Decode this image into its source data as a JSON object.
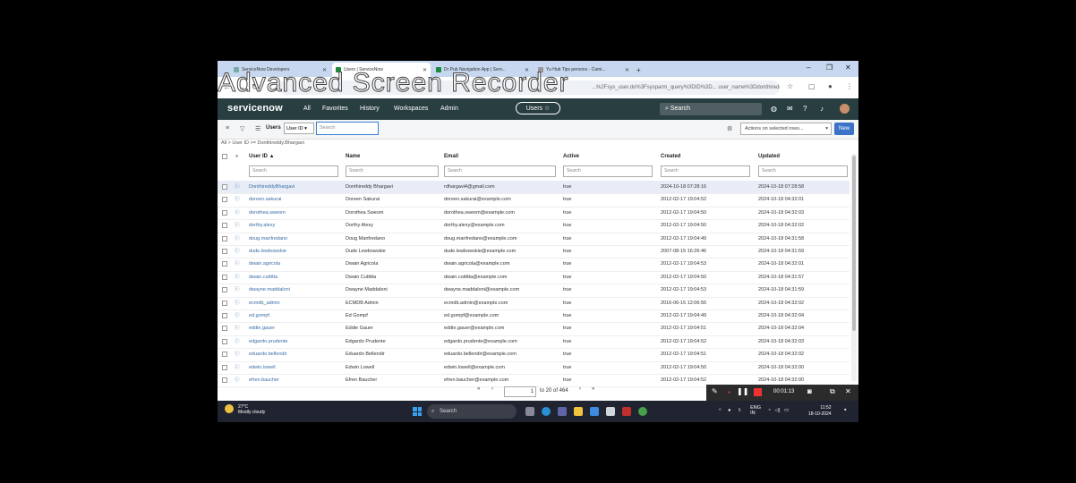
{
  "watermark": "Advanced Screen Recorder",
  "browser": {
    "tabs": [
      {
        "label": "ServiceNow Developers",
        "active": false
      },
      {
        "label": "Users | ServiceNow",
        "active": true
      },
      {
        "label": "Dr Pub Navigation App | Serv...",
        "active": false
      },
      {
        "label": "Yu Hub Tips persons - Cami...",
        "active": false
      }
    ],
    "new_tab": "+",
    "url": "...%2Fsys_user.do%3Fsysparm_query%3DID%3D... user_name%3Ddonthireddy.bhargavi%26sysparm..."
  },
  "sn": {
    "logo": "servicenow",
    "menu": [
      "All",
      "Favorites",
      "History",
      "Workspaces",
      "Admin"
    ],
    "context_pill": "Users ☆",
    "global_search": "Search"
  },
  "list": {
    "title": "Users",
    "field_select": "User ID",
    "search_placeholder": "Search",
    "actions_select": "Actions on selected rows...",
    "new_button": "New",
    "breadcrumb": "All > User ID >= Donthireddy.Bhargavi",
    "columns": [
      "User ID ▲",
      "Name",
      "Email",
      "Active",
      "Created",
      "Updated"
    ],
    "column_search": "Search",
    "rows": [
      {
        "user_id": "DonthireddyBhargavi",
        "name": "Donthireddy Bhargavi",
        "email": "rdhargavi4@gmail.com",
        "active": "true",
        "created": "2024-10-18 07:28:16",
        "updated": "2024-10-18 07:28:58"
      },
      {
        "user_id": "doreen.sakurai",
        "name": "Doreen Sakurai",
        "email": "doreen.sakurai@example.com",
        "active": "true",
        "created": "2012-02-17 19:04:52",
        "updated": "2024-10-18 04:32:01"
      },
      {
        "user_id": "dorothea.sweom",
        "name": "Dorothea Sweom",
        "email": "dorothea.sweom@example.com",
        "active": "true",
        "created": "2012-02-17 19:04:50",
        "updated": "2024-10-18 04:32:03"
      },
      {
        "user_id": "dorthy.alexy",
        "name": "Dorthy Alexy",
        "email": "dorthy.alexy@example.com",
        "active": "true",
        "created": "2012-02-17 19:04:50",
        "updated": "2024-10-18 04:32:02"
      },
      {
        "user_id": "doug.manfredano",
        "name": "Doug Manfredano",
        "email": "doug.manfredano@example.com",
        "active": "true",
        "created": "2012-02-17 19:04:49",
        "updated": "2024-10-18 04:31:58"
      },
      {
        "user_id": "dude.lewbowskie",
        "name": "Dude Lewbowskie",
        "email": "dude.lewbowskie@example.com",
        "active": "true",
        "created": "2007-08-15 16:26:46",
        "updated": "2024-10-18 04:31:59"
      },
      {
        "user_id": "dwain.agricola",
        "name": "Dwain Agricola",
        "email": "dwain.agricola@example.com",
        "active": "true",
        "created": "2012-02-17 19:04:53",
        "updated": "2024-10-18 04:32:01"
      },
      {
        "user_id": "dwain.cuttitta",
        "name": "Dwain Cuttitta",
        "email": "dwain.cuttitta@example.com",
        "active": "true",
        "created": "2012-02-17 19:04:50",
        "updated": "2024-10-18 04:31:57"
      },
      {
        "user_id": "dwayne.maddaloni",
        "name": "Dwayne Maddaloni",
        "email": "dwayne.maddaloni@example.com",
        "active": "true",
        "created": "2012-02-17 19:04:53",
        "updated": "2024-10-18 04:31:59"
      },
      {
        "user_id": "ecmdb_admin",
        "name": "ECMDB Admin",
        "email": "ecmdb.admin@example.com",
        "active": "true",
        "created": "2016-06-15 12:06:55",
        "updated": "2024-10-18 04:32:02"
      },
      {
        "user_id": "ed.gompf",
        "name": "Ed Gompf",
        "email": "ed.gompf@example.com",
        "active": "true",
        "created": "2012-02-17 19:04:49",
        "updated": "2024-10-18 04:32:04"
      },
      {
        "user_id": "eddie.gauer",
        "name": "Eddie Gauer",
        "email": "eddie.gauer@example.com",
        "active": "true",
        "created": "2012-02-17 19:04:51",
        "updated": "2024-10-18 04:32:04"
      },
      {
        "user_id": "edgardo.prudente",
        "name": "Edgardo Prudente",
        "email": "edgardo.prudente@example.com",
        "active": "true",
        "created": "2012-02-17 19:04:52",
        "updated": "2024-10-18 04:32:03"
      },
      {
        "user_id": "eduardo.bellendir",
        "name": "Eduardo Bellendir",
        "email": "eduardo.bellendir@example.com",
        "active": "true",
        "created": "2012-02-17 19:04:51",
        "updated": "2024-10-18 04:32:02"
      },
      {
        "user_id": "edwin.lowell",
        "name": "Edwin Lowell",
        "email": "edwin.lowell@example.com",
        "active": "true",
        "created": "2012-02-17 19:04:50",
        "updated": "2024-10-18 04:32:00"
      },
      {
        "user_id": "efren.baucher",
        "name": "Efren Baucher",
        "email": "efren.baucher@example.com",
        "active": "true",
        "created": "2012-02-17 19:04:52",
        "updated": "2024-10-18 04:32:00"
      }
    ],
    "pager": {
      "first": "«",
      "prev": "‹",
      "page": "1",
      "range": "to 20 of 464",
      "next": "›",
      "last": "»"
    }
  },
  "recorder": {
    "time": "00:01:13"
  },
  "taskbar": {
    "weather_temp": "27°C",
    "weather_text": "Mostly cloudy",
    "search": "Search",
    "lang": "ENG",
    "region": "IN",
    "time": "11:52",
    "date": "18-10-2024"
  }
}
